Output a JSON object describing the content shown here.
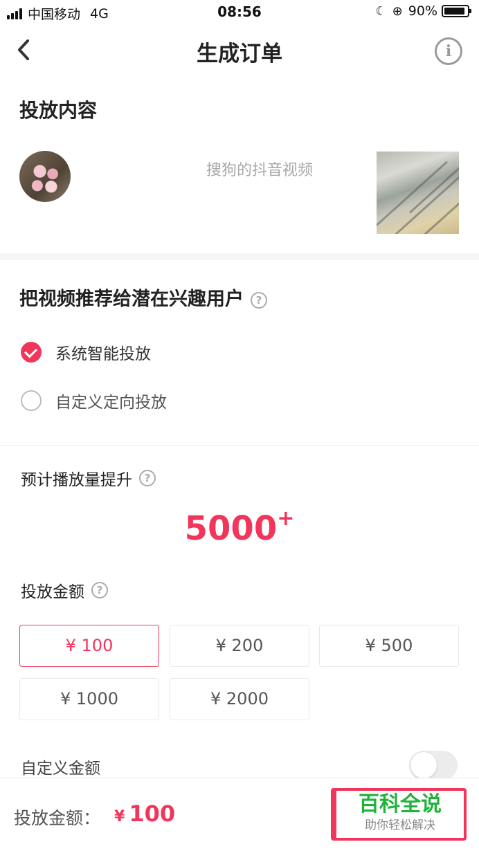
{
  "status_bar": {
    "carrier": "中国移动",
    "network": "4G",
    "time": "08:56",
    "battery": "90%",
    "battery_level": 0.9
  },
  "nav": {
    "title": "生成订单",
    "back_icon": "chevron-left-icon",
    "info_icon": "info-icon",
    "info_glyph": "i"
  },
  "content": {
    "section_title": "投放内容",
    "video_title": "搜狗的抖音视频"
  },
  "targeting": {
    "section_title": "把视频推荐给潜在兴趣用户",
    "help_glyph": "?",
    "options": [
      {
        "label": "系统智能投放",
        "selected": true
      },
      {
        "label": "自定义定向投放",
        "selected": false
      }
    ]
  },
  "estimate": {
    "label": "预计播放量提升",
    "value": "5000",
    "suffix": "+"
  },
  "amount": {
    "label": "投放金额",
    "options": [
      "¥ 100",
      "¥ 200",
      "¥ 500",
      "¥ 1000",
      "¥ 2000"
    ],
    "selected_index": 0,
    "custom_label": "自定义金额",
    "custom_enabled": false
  },
  "bottom_bar": {
    "label": "投放金额：",
    "currency": "¥",
    "amount": "100"
  },
  "watermark": {
    "title": "百科全说",
    "subtitle": "助你轻松解决"
  },
  "colors": {
    "accent": "#f0365b",
    "watermark_green": "#1fb33a"
  }
}
